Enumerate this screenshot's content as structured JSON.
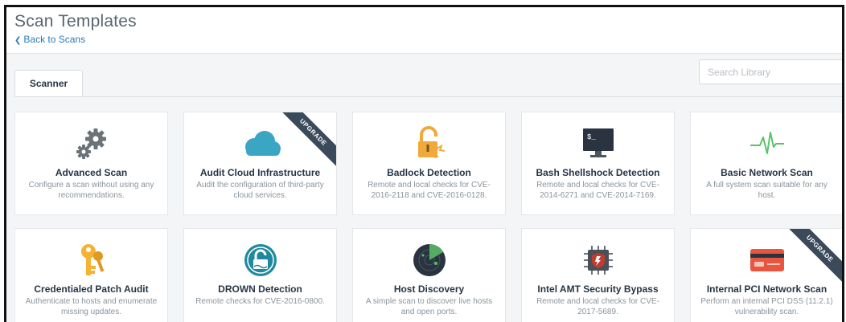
{
  "header": {
    "title": "Scan Templates",
    "back_label": "Back to Scans"
  },
  "tabs": [
    {
      "label": "Scanner"
    }
  ],
  "search": {
    "placeholder": "Search Library",
    "value": ""
  },
  "templates": [
    {
      "name": "Advanced Scan",
      "description": "Configure a scan without using any recommendations.",
      "icon": "gears-icon",
      "badge": ""
    },
    {
      "name": "Audit Cloud Infrastructure",
      "description": "Audit the configuration of third-party cloud services.",
      "icon": "cloud-icon",
      "badge": "UPGRADE"
    },
    {
      "name": "Badlock Detection",
      "description": "Remote and local checks for CVE-2016-2118 and CVE-2016-0128.",
      "icon": "broken-lock-icon",
      "badge": ""
    },
    {
      "name": "Bash Shellshock Detection",
      "description": "Remote and local checks for CVE-2014-6271 and CVE-2014-7169.",
      "icon": "terminal-monitor-icon",
      "badge": ""
    },
    {
      "name": "Basic Network Scan",
      "description": "A full system scan suitable for any host.",
      "icon": "pulse-icon",
      "badge": ""
    },
    {
      "name": "Credentialed Patch Audit",
      "description": "Authenticate to hosts and enumerate missing updates.",
      "icon": "keys-icon",
      "badge": ""
    },
    {
      "name": "DROWN Detection",
      "description": "Remote checks for CVE-2016-0800.",
      "icon": "drown-lock-icon",
      "badge": ""
    },
    {
      "name": "Host Discovery",
      "description": "A simple scan to discover live hosts and open ports.",
      "icon": "radar-icon",
      "badge": ""
    },
    {
      "name": "Intel AMT Security Bypass",
      "description": "Remote and local checks for CVE-2017-5689.",
      "icon": "chip-shield-icon",
      "badge": ""
    },
    {
      "name": "Internal PCI Network Scan",
      "description": "Perform an internal PCI DSS (11.2.1) vulnerability scan.",
      "icon": "credit-card-icon",
      "badge": "UPGRADE"
    }
  ],
  "colors": {
    "link": "#2b7bb9",
    "ribbon": "#3a4a5a",
    "cloud": "#3aa6c4",
    "lock": "#f0a93b",
    "pulse": "#5cc16a",
    "key": "#f5b335",
    "drown": "#1f8a9e",
    "radar": "#2a3440",
    "chip": "#c23b30",
    "card": "#e8563f"
  }
}
